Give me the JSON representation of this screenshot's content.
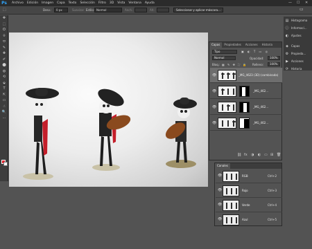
{
  "menubar": {
    "logo": "Ps",
    "items": [
      "Archivo",
      "Edición",
      "Imagen",
      "Capa",
      "Texto",
      "Selección",
      "Filtro",
      "3D",
      "Vista",
      "Ventana",
      "Ayuda"
    ],
    "minimize": "—",
    "maximize": "☐",
    "close": "✕"
  },
  "options": {
    "tool_icon": "⬚",
    "desvan_label": "Desv.:",
    "desvan_value": "0 px",
    "suavizar_label": "Suavizar",
    "estilo_label": "Estilo:",
    "estilo_value": "Normal",
    "anch_label": "Anch.:",
    "alt_label": "Alt.:",
    "refine_button": "Seleccionar y aplicar máscara...",
    "workspace_icon": "▭"
  },
  "tools": [
    "✥",
    "⬚",
    "ʘ",
    "⌾",
    "⬭",
    "✎",
    "✚",
    "✐",
    "⬤",
    "◍",
    "⟲",
    "⬙",
    "T",
    "⇱",
    "▭",
    "☝",
    "🔍",
    "⋯"
  ],
  "dock": {
    "items": [
      {
        "icon": "▤",
        "label": "Histograma"
      },
      {
        "icon": "ⓘ",
        "label": "Informaci..."
      },
      {
        "icon": "◐",
        "label": "Ajustes"
      },
      {
        "icon": "◈",
        "label": "Capas"
      },
      {
        "icon": "⚙",
        "label": "Propieda..."
      },
      {
        "icon": "▶",
        "label": "Acciones"
      },
      {
        "icon": "⟳",
        "label": "Historia"
      }
    ]
  },
  "layers_panel": {
    "tabs": [
      "Capas",
      "Propiedades",
      "Acciones",
      "Historia"
    ],
    "filter_label": "Tipo",
    "blend_mode": "Normal",
    "opacity_label": "Opacidad:",
    "opacity_value": "100%",
    "lock_label": "Bloq.:",
    "fill_label": "Relleno:",
    "fill_value": "100%",
    "layers": [
      {
        "name": "_MG_4623 (3D) (combinada)",
        "selected": true,
        "has_mask": false
      },
      {
        "name": "_MG_462...",
        "selected": false,
        "has_mask": true
      },
      {
        "name": "_MG_462...",
        "selected": false,
        "has_mask": true
      },
      {
        "name": "_MG_462...",
        "selected": false,
        "has_mask": true
      }
    ],
    "footer_icons": [
      "⛓",
      "fx",
      "◑",
      "◐",
      "▭",
      "⊞",
      "🗑"
    ]
  },
  "channels_panel": {
    "title": "Canales",
    "channels": [
      {
        "name": "RGB",
        "shortcut": "Ctrl+2"
      },
      {
        "name": "Rojo",
        "shortcut": "Ctrl+3"
      },
      {
        "name": "Verde",
        "shortcut": "Ctrl+4"
      },
      {
        "name": "Azul",
        "shortcut": "Ctrl+5"
      }
    ],
    "footer_icons": [
      "◌",
      "◍",
      "▣",
      "⊞",
      "🗑"
    ]
  },
  "colors": {
    "foreground": "#e5202a",
    "background": "#ffffff",
    "accent": "#31a8ff"
  }
}
